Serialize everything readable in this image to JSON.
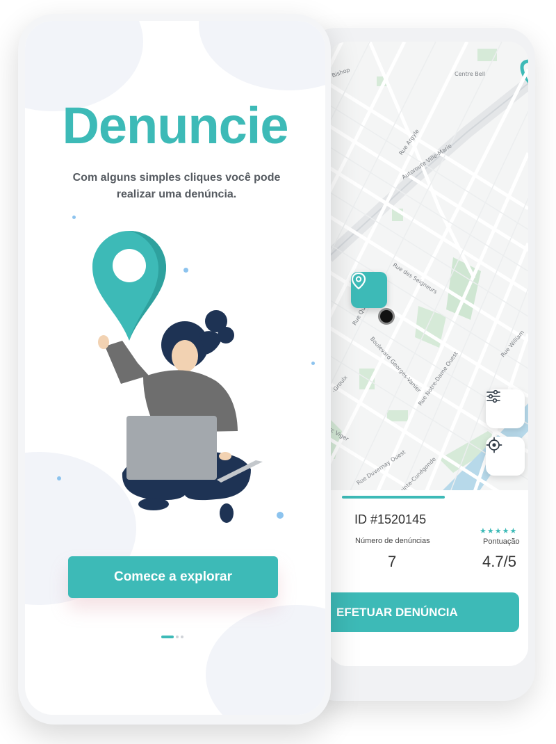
{
  "colors": {
    "accent": "#3dbab7",
    "text_dark": "#333333",
    "text_gray": "#555a60"
  },
  "onboarding": {
    "title": "Denuncie",
    "subtitle": "Com alguns simples cliques você pode realizar uma denúncia.",
    "cta_label": "Comece a explorar",
    "pager": {
      "total": 3,
      "active": 1
    }
  },
  "map": {
    "streets": {
      "bishop": "Bishop",
      "centre_bell": "Centre Bell",
      "argyle": "Rue Argyle",
      "ville_marie": "Autoroute Ville-Marie",
      "seigneurs": "Rue des Seigneurs",
      "qu": "Rue Qu",
      "georges_vanier": "Boulevard Georges-Vanier",
      "notre_dame": "Rue Notre-Dame Ouest",
      "william": "Rue William",
      "groulx": "-Groulx",
      "viger": "rc Viger",
      "duvernay": "Rue Duvernay Ouest",
      "cunegonde": "ue Sainte-Cunégonde"
    },
    "filter_icon": "sliders-icon",
    "locate_icon": "crosshair-icon",
    "pin_icon": "map-pin-icon"
  },
  "report": {
    "id_label": "ID #1520145",
    "count_label": "Número de denúncias",
    "count_value": "7",
    "score_label": "Pontuação",
    "score_value": "4.7/5",
    "stars": "★★★★★",
    "action_label": "EFETUAR DENÚNCIA"
  }
}
